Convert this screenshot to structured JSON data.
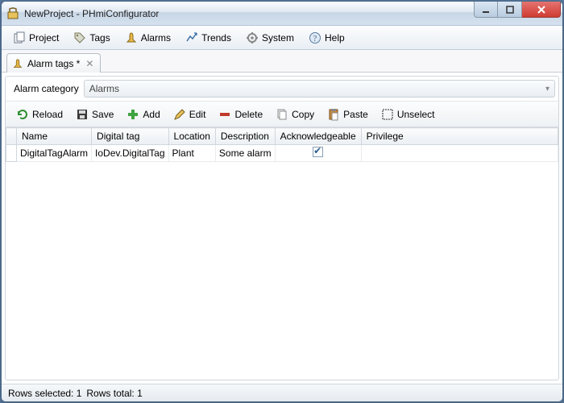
{
  "window": {
    "title": "NewProject - PHmiConfigurator"
  },
  "menubar": [
    {
      "label": "Project",
      "icon": "project-icon"
    },
    {
      "label": "Tags",
      "icon": "tags-icon"
    },
    {
      "label": "Alarms",
      "icon": "alarms-icon"
    },
    {
      "label": "Trends",
      "icon": "trends-icon"
    },
    {
      "label": "System",
      "icon": "system-icon"
    },
    {
      "label": "Help",
      "icon": "help-icon"
    }
  ],
  "tab": {
    "label": "Alarm tags *"
  },
  "category": {
    "label": "Alarm category",
    "value": "Alarms"
  },
  "toolbar": {
    "reload": "Reload",
    "save": "Save",
    "add": "Add",
    "edit": "Edit",
    "delete": "Delete",
    "copy": "Copy",
    "paste": "Paste",
    "unselect": "Unselect"
  },
  "grid": {
    "columns": [
      "Name",
      "Digital tag",
      "Location",
      "Description",
      "Acknowledgeable",
      "Privilege"
    ],
    "rows": [
      {
        "name": "DigitalTagAlarm",
        "digital_tag": "IoDev.DigitalTag",
        "location": "Plant",
        "description": "Some alarm",
        "acknowledgeable": true,
        "privilege": ""
      }
    ]
  },
  "status": {
    "selected": "Rows selected: 1",
    "total": "Rows total: 1"
  }
}
